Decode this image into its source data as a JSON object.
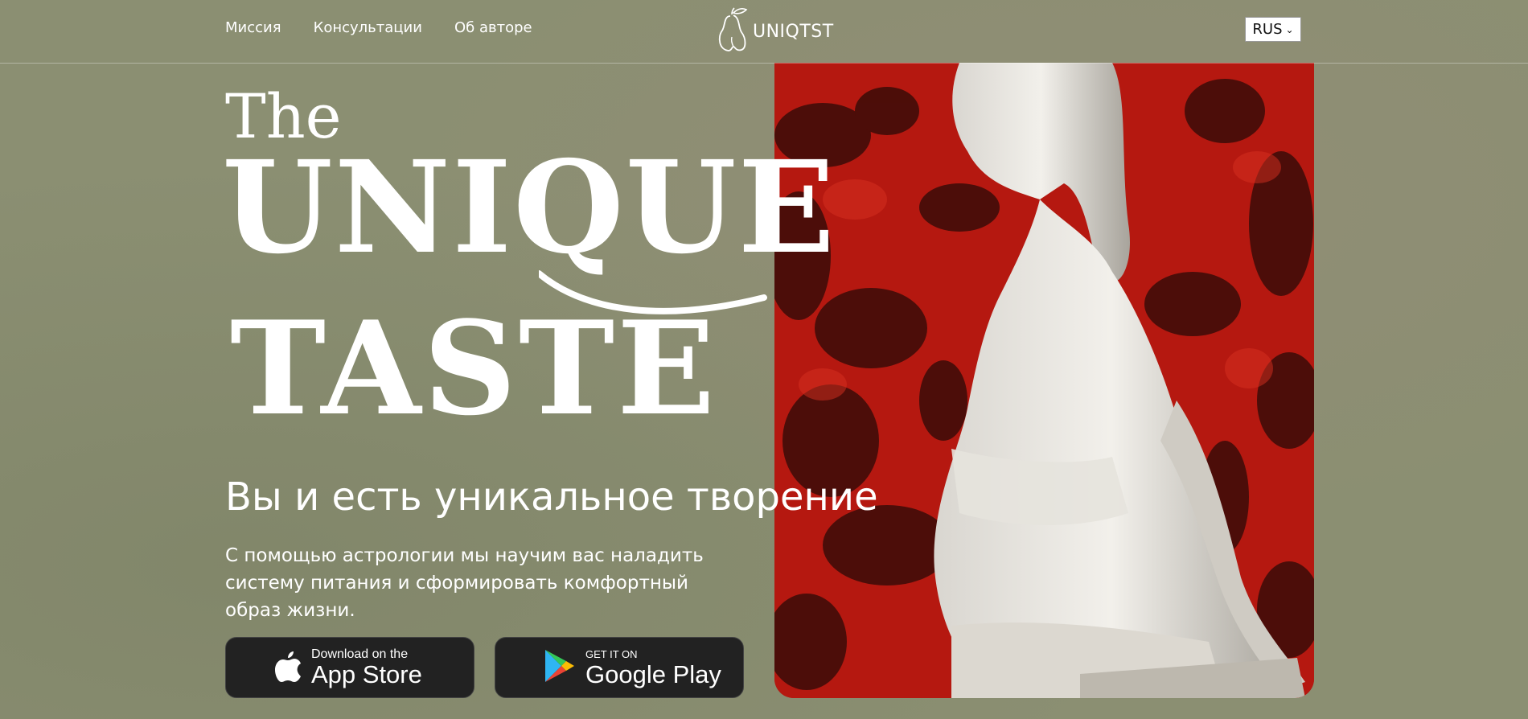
{
  "nav": {
    "items": [
      {
        "label": "Миссия"
      },
      {
        "label": "Консультации"
      },
      {
        "label": "Об авторе"
      }
    ]
  },
  "logo": {
    "text": "UNIQTST",
    "icon": "pear-icon"
  },
  "language": {
    "selected": "RUS"
  },
  "hero": {
    "the": "The",
    "unique": "UNIQUE",
    "taste": "TASTE",
    "subtitle": "Вы и есть уникальное творение",
    "description": "С помощью астрологии мы научим вас наладить систему питания и сформировать комфортный образ жизни."
  },
  "stores": {
    "apple": {
      "small": "Download on the",
      "big": "App Store",
      "icon": "apple-icon"
    },
    "google": {
      "small": "GET IT ON",
      "big": "Google Play",
      "icon": "google-play-icon"
    }
  },
  "colors": {
    "background": "#8b8f72",
    "accent_red": "#b51810",
    "button_bg": "#222222"
  }
}
